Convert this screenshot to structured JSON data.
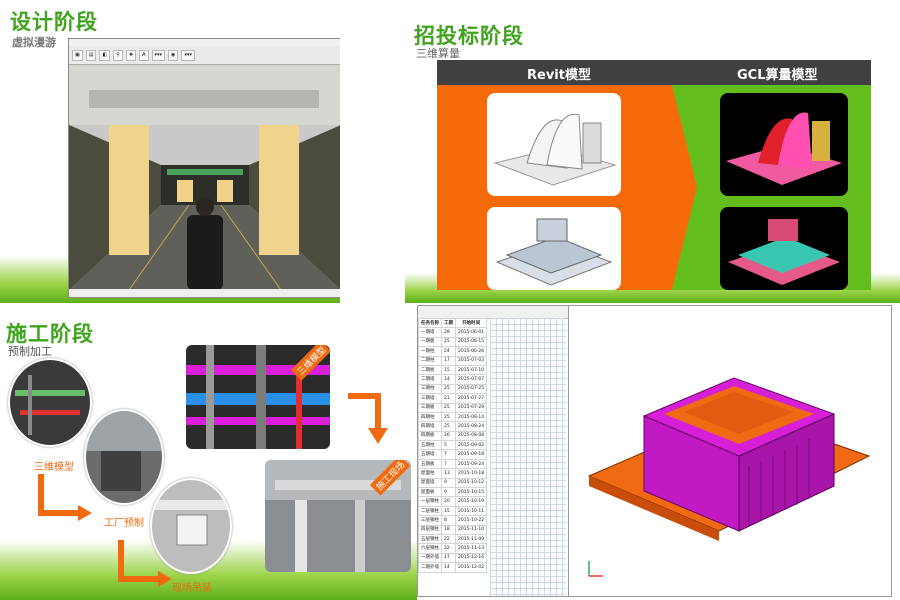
{
  "design": {
    "title": "设计阶段",
    "subtitle": "虚拟漫游"
  },
  "bidding": {
    "title": "招投标阶段",
    "subtitle": "三维算量",
    "col_left": "Revit模型",
    "col_right": "GCL算量模型"
  },
  "construction": {
    "title": "施工阶段",
    "subtitle": "预制加工",
    "step1": "三维模型",
    "step2": "工厂预制",
    "step3": "现场吊装",
    "tag1": "三维模型",
    "tag2": "施工现场"
  },
  "colors": {
    "title_green": "#3fa31e",
    "orange": "#f56b0c",
    "green": "#63bd1c",
    "magenta": "#d61fd6"
  },
  "schedule": {
    "columns": [
      "任务名称",
      "工期",
      "开始时间"
    ],
    "rows": [
      [
        "一期墙",
        "28",
        "2015-06-01"
      ],
      [
        "一期板",
        "25",
        "2015-06-15"
      ],
      [
        "一期柱",
        "24",
        "2015-06-26"
      ],
      [
        "二期柱",
        "17",
        "2015-07-03"
      ],
      [
        "二期板",
        "15",
        "2015-07-10"
      ],
      [
        "二期墙",
        "14",
        "2015-07-07"
      ],
      [
        "三期柱",
        "25",
        "2015-07-25"
      ],
      [
        "三期墙",
        "21",
        "2015-07-27"
      ],
      [
        "三期板",
        "25",
        "2015-07-29"
      ],
      [
        "四期柱",
        "25",
        "2015-08-14"
      ],
      [
        "四期墙",
        "25",
        "2015-08-24"
      ],
      [
        "四期板",
        "26",
        "2015-08-08"
      ],
      [
        "五期柱",
        "5",
        "2015-09-02"
      ],
      [
        "五期墙",
        "7",
        "2015-09-18"
      ],
      [
        "五期板",
        "7",
        "2015-09-24"
      ],
      [
        "屋面柱",
        "13",
        "2015-10-18"
      ],
      [
        "屋面墙",
        "9",
        "2015-10-12"
      ],
      [
        "屋面板",
        "9",
        "2015-10-15"
      ],
      [
        "一层钢柱",
        "20",
        "2015-10-19"
      ],
      [
        "二层钢柱",
        "15",
        "2015-10-11"
      ],
      [
        "三层钢柱",
        "8",
        "2015-10-22"
      ],
      [
        "四层钢柱",
        "18",
        "2015-11-10"
      ],
      [
        "五层钢柱",
        "22",
        "2015-11-09"
      ],
      [
        "六层钢柱",
        "22",
        "2015-11-13"
      ],
      [
        "一期外墙",
        "17",
        "2015-12-16"
      ],
      [
        "二期外墙",
        "14",
        "2015-12-02"
      ]
    ]
  }
}
